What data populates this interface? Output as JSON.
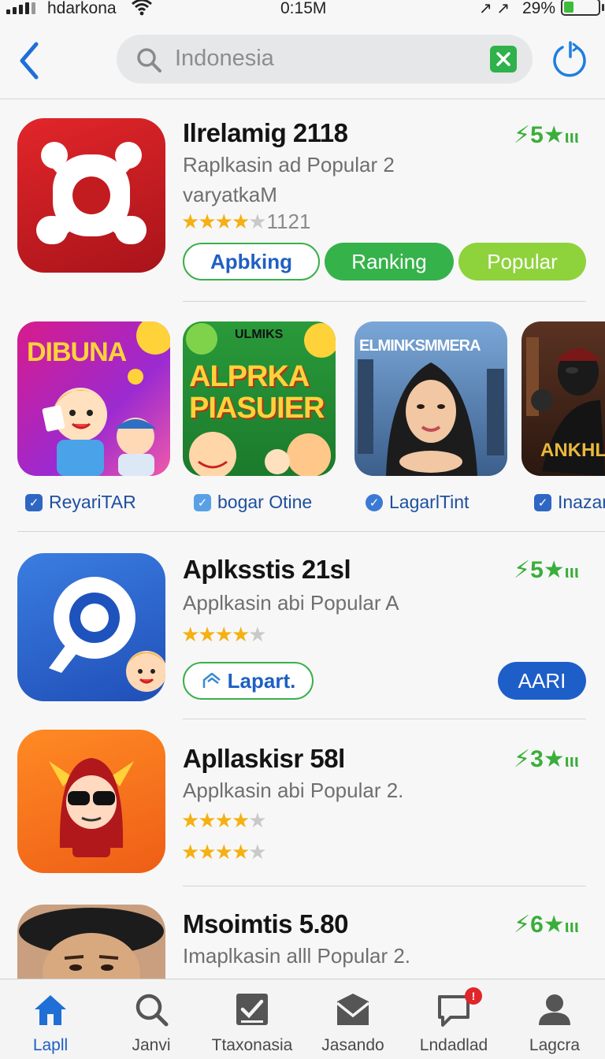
{
  "status_bar": {
    "carrier": "hdarkona",
    "time": "0:15M",
    "arrows": "↗ ↗",
    "battery_pct": "29%",
    "battery_level": 0.29
  },
  "search": {
    "value": "Indonesia"
  },
  "colors": {
    "accent_green": "#3aae3a",
    "accent_blue": "#1f5fc2",
    "star": "#f5b012"
  },
  "apps": [
    {
      "title": "Ilrelamig 2118",
      "subtitle": "Raplkasin ad Popular 2",
      "subtitle2": "varyatkaM",
      "badge": "⚡5★",
      "badge_suffix": "ιιι",
      "stars": 4.0,
      "review_count": "1121",
      "buttons": [
        "Apbking",
        "Ranking",
        "Popular"
      ]
    },
    {
      "title": "Aplksstis 21sl",
      "subtitle": "Applkasin abi Popular A",
      "badge": "⚡5★",
      "badge_suffix": "ιιι",
      "stars": 3.5,
      "buttons": [
        "Lapart.",
        "AARI"
      ]
    },
    {
      "title": "Apllaskisr 58l",
      "subtitle": "Applkasin abi Popular 2.",
      "badge": "⚡3★",
      "badge_suffix": "ιιι",
      "stars": 3.5,
      "stars2": 3.5
    },
    {
      "title": "Msoimtis 5.80",
      "subtitle": "Imaplkasin alll Popular 2.",
      "badge": "⚡6★",
      "badge_suffix": "ιιι"
    }
  ],
  "carousel": [
    {
      "art_text": "DIBUNA",
      "label": "ReyariTAR"
    },
    {
      "art_text_top": "ULMIKS",
      "art_text": "ALPRKA PIASUIER",
      "label": "bogar Otine"
    },
    {
      "art_text": "ELMINKSMMERA",
      "label": "LagarlTint"
    },
    {
      "art_text": "ANKHLA",
      "label": "Inazar"
    }
  ],
  "tabs": [
    {
      "label": "Lapll",
      "icon": "home-icon"
    },
    {
      "label": "Janvi",
      "icon": "search-icon"
    },
    {
      "label": "Ttaxonasia",
      "icon": "checklist-icon"
    },
    {
      "label": "Jasando",
      "icon": "inbox-icon"
    },
    {
      "label": "Lndadlad",
      "icon": "chat-icon",
      "badge": "!"
    },
    {
      "label": "Lagcra",
      "icon": "profile-icon"
    }
  ]
}
